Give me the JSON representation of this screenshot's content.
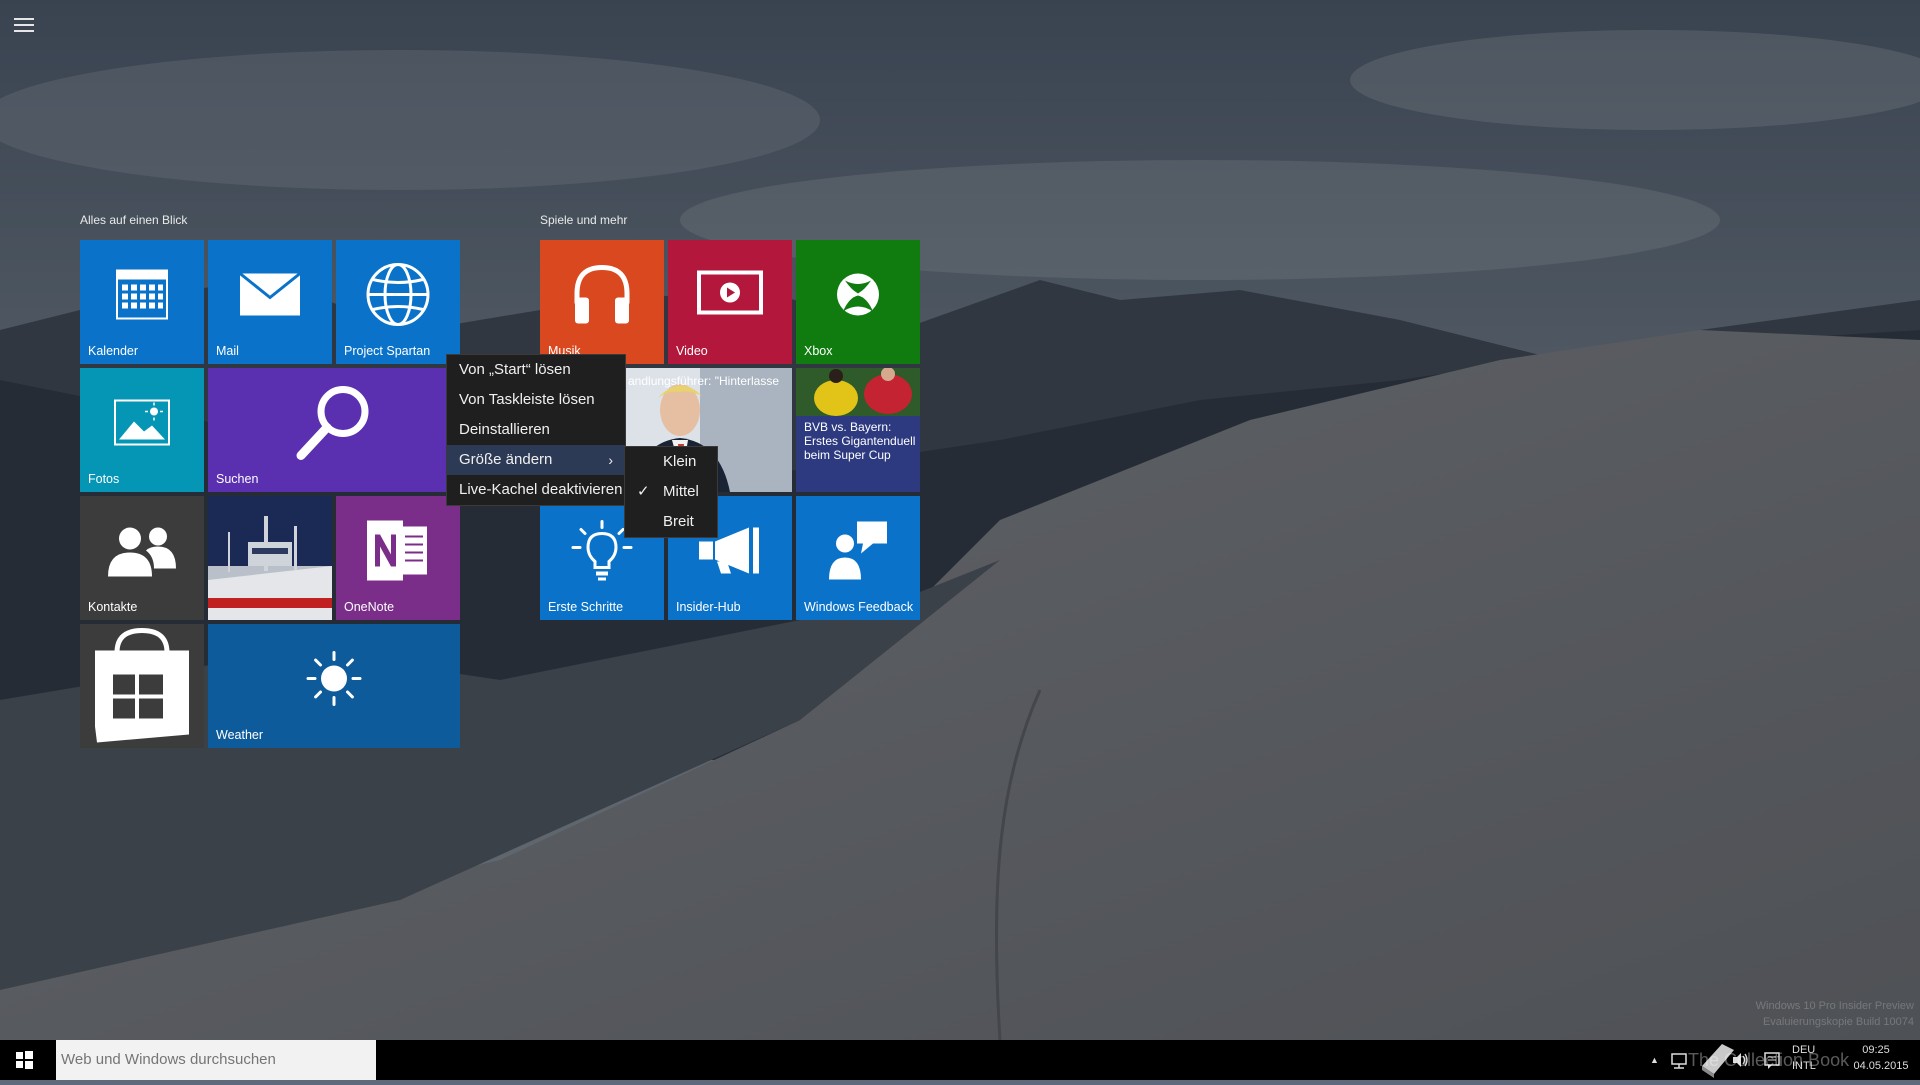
{
  "groups": [
    {
      "title": "Alles auf einen Blick"
    },
    {
      "title": "Spiele und mehr"
    }
  ],
  "tiles": {
    "kalender": {
      "label": "Kalender",
      "color": "#0a73c9"
    },
    "mail": {
      "label": "Mail",
      "color": "#0a73c9"
    },
    "spartan": {
      "label": "Project Spartan",
      "color": "#0a73c9"
    },
    "fotos": {
      "label": "Fotos",
      "color": "#0596b5"
    },
    "suchen": {
      "label": "Suchen",
      "color": "#5a2fb0"
    },
    "kontakte": {
      "label": "Kontakte",
      "color": "#3c3c3c"
    },
    "onenote": {
      "label": "OneNote",
      "color": "#7a2e8a"
    },
    "store": {
      "label": "",
      "color": "#3c3c3c"
    },
    "weather": {
      "label": "Weather",
      "color": "#0e5b9c"
    },
    "musik": {
      "label": "Musik",
      "color": "#d9481f"
    },
    "video": {
      "label": "Video",
      "color": "#b3183c"
    },
    "xbox": {
      "label": "Xbox",
      "color": "#107c10"
    },
    "news": {
      "label": "andlungsführer: \"Hinterlasse"
    },
    "sport": {
      "label": "BVB vs. Bayern: Erstes Gigantenduell beim Super Cup",
      "color": "#2d3a80"
    },
    "erste": {
      "label": "Erste Schritte",
      "color": "#0a73c9"
    },
    "insider": {
      "label": "Insider-Hub",
      "color": "#0a73c9"
    },
    "feedback": {
      "label": "Windows Feedback",
      "color": "#0a73c9"
    }
  },
  "context_menu": {
    "items": [
      "Von „Start“ lösen",
      "Von Taskleiste lösen",
      "Deinstallieren",
      "Größe ändern",
      "Live-Kachel deaktivieren"
    ],
    "active_index": 3,
    "submenu": {
      "items": [
        "Klein",
        "Mittel",
        "Breit"
      ],
      "checked_index": 1,
      "check_glyph": "✓"
    }
  },
  "taskbar": {
    "search_placeholder": "Web und Windows durchsuchen",
    "lang_top": "DEU",
    "lang_bottom": "INTL",
    "time": "09:25",
    "date": "04.05.2015"
  },
  "watermark": {
    "line1": "Windows 10 Pro Insider Preview",
    "line2": "Evaluierungskopie Build 10074",
    "brand": "The Collection Book"
  }
}
